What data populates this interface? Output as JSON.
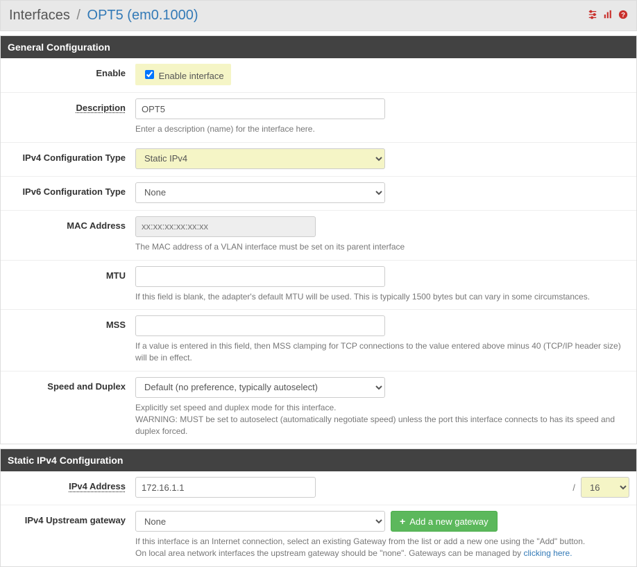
{
  "breadcrumb": {
    "root": "Interfaces",
    "leaf": "OPT5 (em0.1000)"
  },
  "iconNames": {
    "settings": "sliders",
    "stats": "stats",
    "help": "help"
  },
  "sections": {
    "general": {
      "heading": "General Configuration",
      "enable": {
        "label": "Enable",
        "checkboxLabel": "Enable interface",
        "checked": true
      },
      "description": {
        "label": "Description",
        "value": "OPT5",
        "help": "Enter a description (name) for the interface here."
      },
      "ipv4type": {
        "label": "IPv4 Configuration Type",
        "value": "Static IPv4"
      },
      "ipv6type": {
        "label": "IPv6 Configuration Type",
        "value": "None"
      },
      "mac": {
        "label": "MAC Address",
        "placeholder": "xx:xx:xx:xx:xx:xx",
        "help": "The MAC address of a VLAN interface must be set on its parent interface"
      },
      "mtu": {
        "label": "MTU",
        "help": "If this field is blank, the adapter's default MTU will be used. This is typically 1500 bytes but can vary in some circumstances."
      },
      "mss": {
        "label": "MSS",
        "help": "If a value is entered in this field, then MSS clamping for TCP connections to the value entered above minus 40 (TCP/IP header size) will be in effect."
      },
      "speed": {
        "label": "Speed and Duplex",
        "value": "Default (no preference, typically autoselect)",
        "help1": "Explicitly set speed and duplex mode for this interface.",
        "help2": "WARNING: MUST be set to autoselect (automatically negotiate speed) unless the port this interface connects to has its speed and duplex forced."
      }
    },
    "static4": {
      "heading": "Static IPv4 Configuration",
      "addr": {
        "label": "IPv4 Address",
        "value": "172.16.1.1",
        "prefix": "16",
        "slash": "/"
      },
      "gw": {
        "label": "IPv4 Upstream gateway",
        "value": "None",
        "addBtn": "Add a new gateway",
        "help1": "If this interface is an Internet connection, select an existing Gateway from the list or add a new one using the \"Add\" button.",
        "help2a": "On local area network interfaces the upstream gateway should be \"none\". Gateways can be managed by ",
        "help2link": "clicking here."
      }
    }
  }
}
